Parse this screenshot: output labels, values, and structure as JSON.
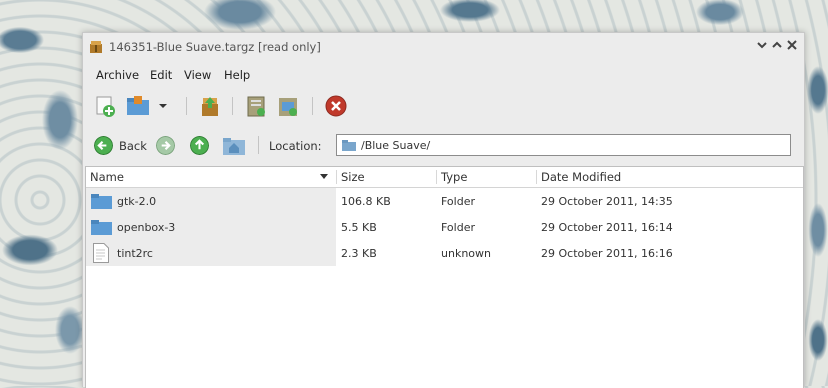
{
  "window": {
    "title": "146351-Blue Suave.targz [read only]",
    "controls": [
      "minimize",
      "maximize",
      "close"
    ]
  },
  "menu": {
    "items": [
      {
        "label": "Archive"
      },
      {
        "label": "Edit"
      },
      {
        "label": "View"
      },
      {
        "label": "Help"
      }
    ]
  },
  "toolbar": {
    "buttons": [
      "new-archive-icon",
      "open-archive-icon",
      "dropdown-arrow-icon",
      "extract-icon",
      "add-files-icon",
      "add-folder-icon",
      "stop-icon"
    ]
  },
  "location": {
    "back_label": "Back",
    "label": "Location:",
    "value": "/Blue Suave/"
  },
  "columns": {
    "name": "Name",
    "size": "Size",
    "type": "Type",
    "date": "Date Modified"
  },
  "files": [
    {
      "name": "gtk-2.0",
      "size": "106.8 KB",
      "type": "Folder",
      "date": "29 October 2011, 14:35",
      "icon": "folder-icon"
    },
    {
      "name": "openbox-3",
      "size": "5.5 KB",
      "type": "Folder",
      "date": "29 October 2011, 16:14",
      "icon": "folder-icon"
    },
    {
      "name": "tint2rc",
      "size": "2.3 KB",
      "type": "unknown",
      "date": "29 October 2011, 16:16",
      "icon": "document-icon"
    }
  ],
  "colors": {
    "folder": "#5b9bd5",
    "nav_green": "#4caf50",
    "stop_red": "#c0392b"
  }
}
